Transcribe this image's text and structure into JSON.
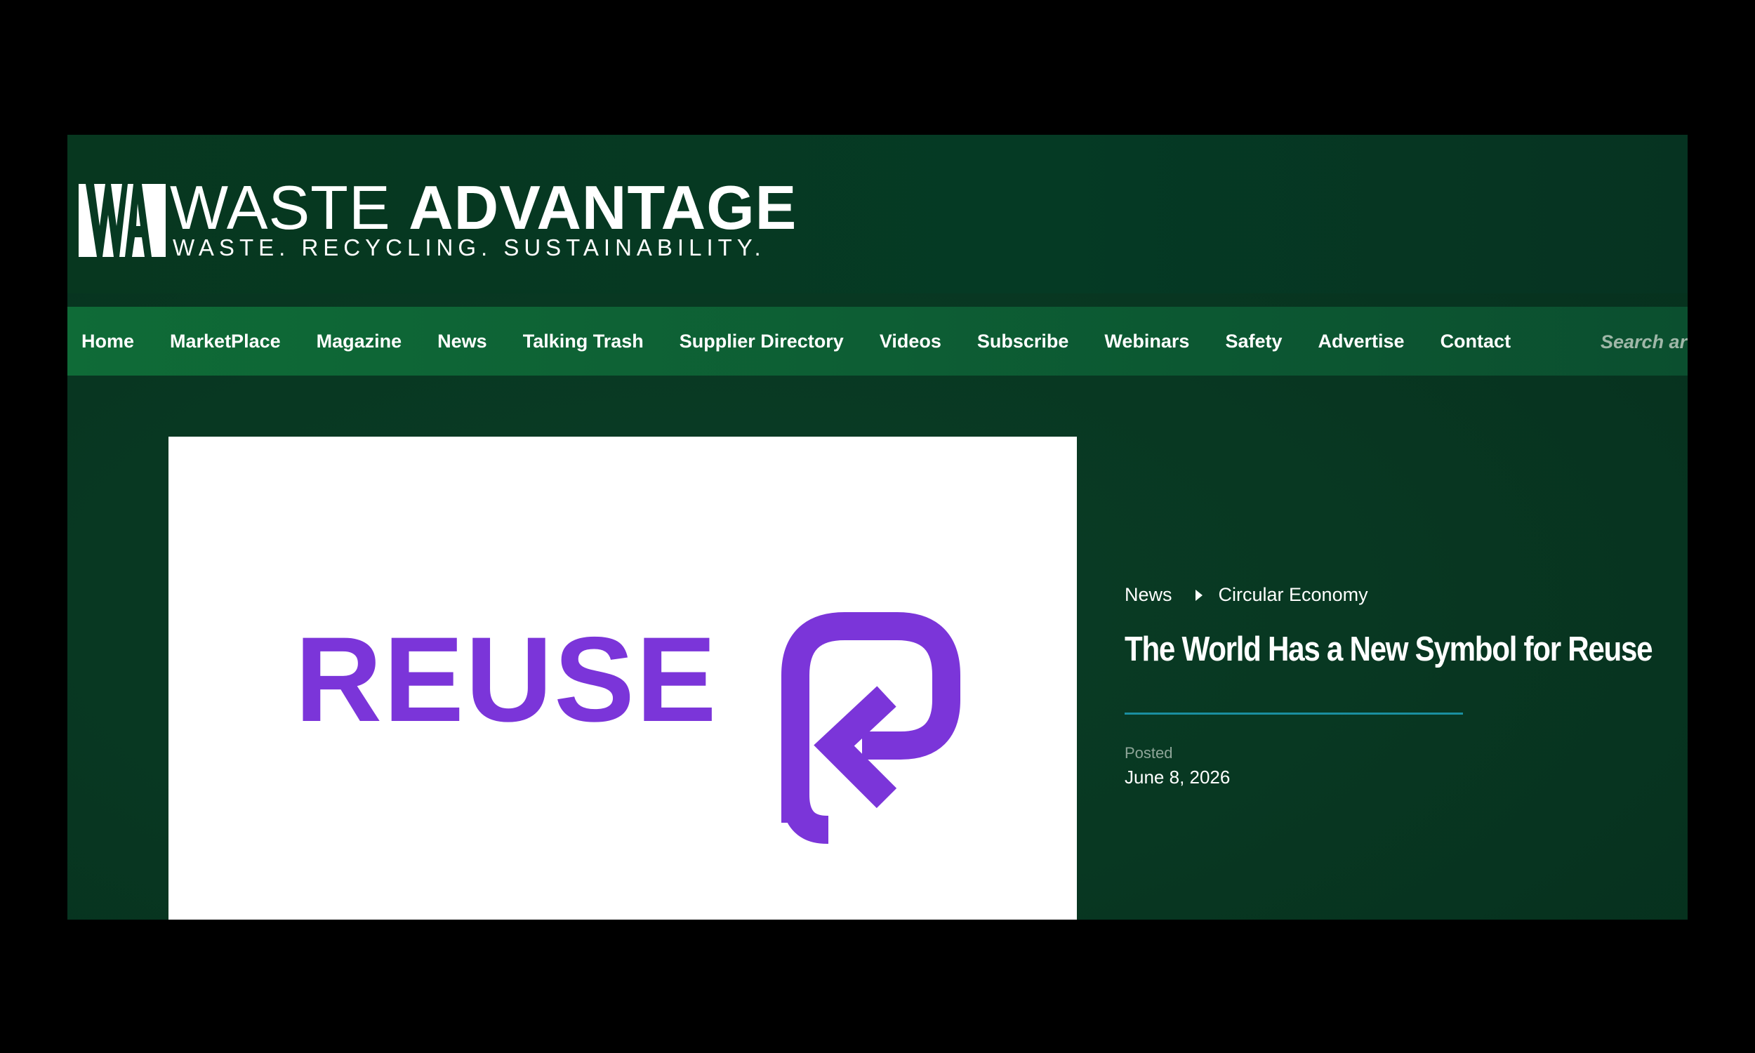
{
  "header": {
    "logo_title_thin": "WASTE",
    "logo_title_bold": "ADVANTAGE",
    "logo_tagline": "WASTE. RECYCLING. SUSTAINABILITY."
  },
  "nav": {
    "items": [
      {
        "label": "Home"
      },
      {
        "label": "MarketPlace"
      },
      {
        "label": "Magazine"
      },
      {
        "label": "News"
      },
      {
        "label": "Talking Trash"
      },
      {
        "label": "Supplier Directory"
      },
      {
        "label": "Videos"
      },
      {
        "label": "Subscribe"
      },
      {
        "label": "Webinars"
      },
      {
        "label": "Safety"
      },
      {
        "label": "Advertise"
      },
      {
        "label": "Contact"
      }
    ],
    "search_placeholder": "Search articles"
  },
  "featured_image": {
    "word": "REUSE",
    "icon": "reuse-symbol-icon",
    "brand_color": "#7b35d9"
  },
  "article": {
    "breadcrumb": [
      "News",
      "Circular Economy"
    ],
    "title": "The World Has a New Symbol for Reuse",
    "posted_label": "Posted",
    "posted_date": "June 8, 2026"
  },
  "colors": {
    "header_bg": "#053a24",
    "nav_bg": "#0f6b37",
    "accent_rule": "#1a8fa0"
  }
}
